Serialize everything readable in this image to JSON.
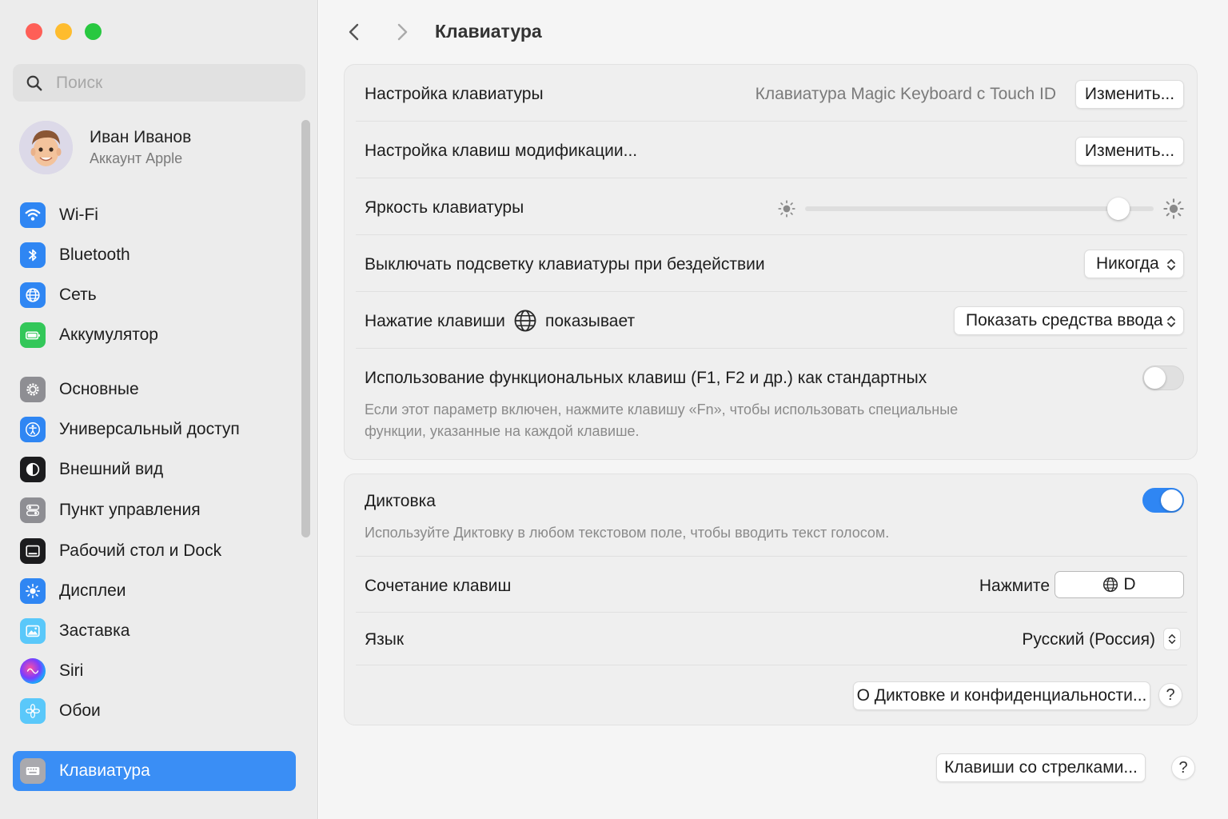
{
  "window": {
    "title": "Клавиатура"
  },
  "sidebar": {
    "search_placeholder": "Поиск",
    "account": {
      "name": "Иван Иванов",
      "subtitle": "Аккаунт Apple"
    },
    "items": [
      {
        "label": "Wi-Fi",
        "icon": "wifi-icon",
        "color": "#2f86f3"
      },
      {
        "label": "Bluetooth",
        "icon": "bluetooth-icon",
        "color": "#2f86f3"
      },
      {
        "label": "Сеть",
        "icon": "globe-icon",
        "color": "#2f86f3"
      },
      {
        "label": "Аккумулятор",
        "icon": "battery-icon",
        "color": "#33c759"
      },
      {
        "label": "Основные",
        "icon": "gear-icon",
        "color": "#8e8e93"
      },
      {
        "label": "Универсальный доступ",
        "icon": "accessibility-icon",
        "color": "#2f86f3"
      },
      {
        "label": "Внешний вид",
        "icon": "appearance-icon",
        "color": "#1c1c1e"
      },
      {
        "label": "Пункт управления",
        "icon": "control-center-icon",
        "color": "#8e8e93"
      },
      {
        "label": "Рабочий стол и Dock",
        "icon": "desktop-dock-icon",
        "color": "#1c1c1e"
      },
      {
        "label": "Дисплеи",
        "icon": "sun-icon",
        "color": "#2f86f3"
      },
      {
        "label": "Заставка",
        "icon": "screensaver-icon",
        "color": "#5ac8fa"
      },
      {
        "label": "Siri",
        "icon": "siri-icon",
        "color": "#1c1c1e"
      },
      {
        "label": "Обои",
        "icon": "wallpaper-flower-icon",
        "color": "#5ac8fa"
      },
      {
        "label": "Клавиатура",
        "icon": "keyboard-icon",
        "color": "#8e8e93",
        "active": true
      }
    ]
  },
  "keyboard_group": {
    "setup": {
      "label": "Настройка клавиатуры",
      "value": "Клавиатура Magic Keyboard с Touch ID",
      "button": "Изменить..."
    },
    "modifiers": {
      "label": "Настройка клавиш модификации...",
      "button": "Изменить..."
    },
    "brightness": {
      "label": "Яркость клавиатуры",
      "level": 0.9
    },
    "backlight_off": {
      "label": "Выключать подсветку клавиатуры при бездействии",
      "value": "Никогда"
    },
    "globe_key": {
      "label_before": "Нажатие клавиши",
      "label_after": "показывает",
      "value": "Показать средства ввода"
    },
    "fn_keys": {
      "label": "Использование функциональных клавиш (F1, F2 и др.) как стандартных",
      "description": "Если этот параметр включен, нажмите клавишу «Fn», чтобы использовать специальные функции, указанные на каждой клавише.",
      "enabled": false
    }
  },
  "dictation_group": {
    "dictation": {
      "label": "Диктовка",
      "description": "Используйте Диктовку в любом текстовом поле, чтобы вводить текст голосом.",
      "enabled": true
    },
    "shortcut": {
      "label": "Сочетание клавиш",
      "prefix": "Нажмите",
      "key": "D"
    },
    "language": {
      "label": "Язык",
      "value": "Русский (Россия)"
    },
    "privacy_button": "О Диктовке и конфиденциальности...",
    "help": "?"
  },
  "footer": {
    "arrow_keys_button": "Клавиши со стрелками...",
    "help": "?"
  },
  "colors": {
    "accent": "#2f86f3",
    "sidebar_bg": "#ececec",
    "main_bg": "#f5f5f5"
  }
}
